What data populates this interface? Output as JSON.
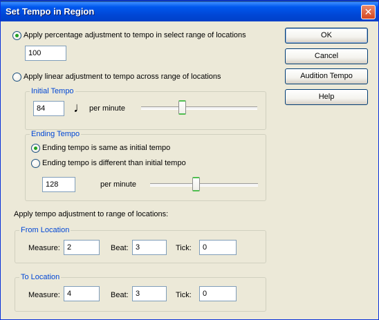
{
  "window": {
    "title": "Set Tempo in Region"
  },
  "icons": {
    "close": "close-icon",
    "note": "quarter-note-icon"
  },
  "percentage": {
    "label": "Apply percentage adjustment to tempo in select range of locations",
    "value": "100",
    "selected": true
  },
  "linear": {
    "label": "Apply linear adjustment to tempo across range of locations",
    "selected": false,
    "initial": {
      "title": "Initial Tempo",
      "value": "84",
      "unit": "per minute",
      "slider_level": 0.35
    },
    "ending": {
      "title": "Ending Tempo",
      "same_label": "Ending tempo is same as initial tempo",
      "same_selected": true,
      "different_label": "Ending tempo is different than initial tempo",
      "different_selected": false,
      "value": "128",
      "unit": "per minute",
      "slider_level": 0.42
    }
  },
  "range": {
    "label": "Apply tempo adjustment to range of locations:",
    "from": {
      "title": "From Location",
      "measure_label": "Measure:",
      "measure": "2",
      "beat_label": "Beat:",
      "beat": "3",
      "tick_label": "Tick:",
      "tick": "0"
    },
    "to": {
      "title": "To Location",
      "measure_label": "Measure:",
      "measure": "4",
      "beat_label": "Beat:",
      "beat": "3",
      "tick_label": "Tick:",
      "tick": "0"
    }
  },
  "buttons": {
    "ok": "OK",
    "cancel": "Cancel",
    "audition": "Audition Tempo",
    "help": "Help"
  }
}
